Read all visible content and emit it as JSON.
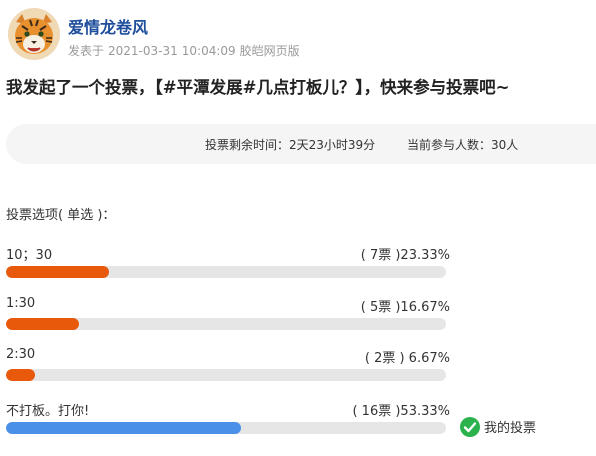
{
  "post": {
    "author": "爱情龙卷风",
    "posted_label": "发表于",
    "date": "2021-03-31",
    "time": "10:04:09",
    "source": "胶皑网页版",
    "title": "我发起了一个投票，【#平潭发展#几点打板儿？】，快来参与投票吧~"
  },
  "vote": {
    "time_left": "投票剩余时间：2天23小时39分",
    "participants": "当前参与人数：30人",
    "options_heading": "投票选项( 单选 )：",
    "options": [
      {
        "label": "10；30",
        "stat": "( 7票 )23.33%",
        "percent": 23.33,
        "mine": false
      },
      {
        "label": "1:30",
        "stat": "( 5票 )16.67%",
        "percent": 16.67,
        "mine": false
      },
      {
        "label": "2:30",
        "stat": "( 2票 ) 6.67%",
        "percent": 6.67,
        "mine": false
      },
      {
        "label": "不打板。打你!",
        "stat": "( 16票 )53.33%",
        "percent": 53.33,
        "mine": true
      }
    ],
    "my_vote_label": "我的投票"
  },
  "colors": {
    "bar_default": "#e8590c",
    "bar_mine": "#4a90e8",
    "track": "#e6e6e6",
    "author": "#1f4e9c",
    "check": "#2bb24c"
  },
  "icons": {
    "avatar": "tiger-avatar",
    "my_vote": "check-circle-icon"
  }
}
